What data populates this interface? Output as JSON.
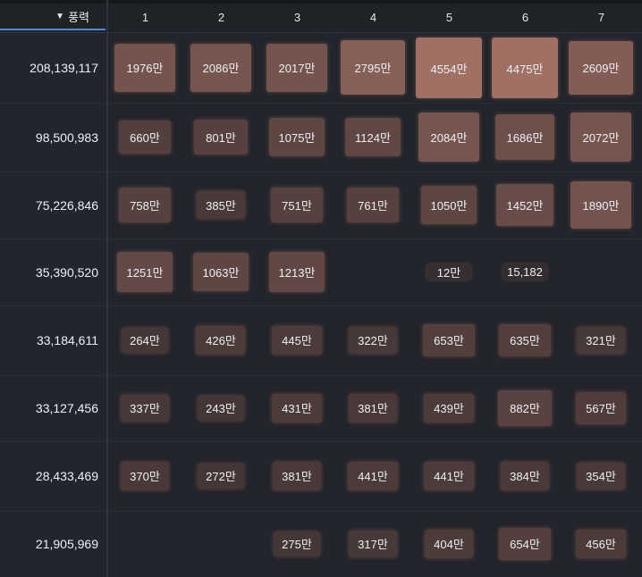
{
  "header": {
    "sort_label": "풍력",
    "sort_icon": "triangle-down-icon",
    "columns": [
      "1",
      "2",
      "3",
      "4",
      "5",
      "6",
      "7"
    ]
  },
  "rows": [
    {
      "label": "208,139,117",
      "cells": [
        "1976만",
        "2086만",
        "2017만",
        "2795만",
        "4554만",
        "4475만",
        "2609만"
      ]
    },
    {
      "label": "98,500,983",
      "cells": [
        "660만",
        "801만",
        "1075만",
        "1124만",
        "2084만",
        "1686만",
        "2072만"
      ]
    },
    {
      "label": "75,226,846",
      "cells": [
        "758만",
        "385만",
        "751만",
        "761만",
        "1050만",
        "1452만",
        "1890만"
      ]
    },
    {
      "label": "35,390,520",
      "cells": [
        "1251만",
        "1063만",
        "1213만",
        "",
        "12만",
        "15,182",
        ""
      ]
    },
    {
      "label": "33,184,611",
      "cells": [
        "264만",
        "426만",
        "445만",
        "322만",
        "653만",
        "635만",
        "321만"
      ]
    },
    {
      "label": "33,127,456",
      "cells": [
        "337만",
        "243만",
        "431만",
        "381만",
        "439만",
        "882만",
        "567만"
      ]
    },
    {
      "label": "28,433,469",
      "cells": [
        "370만",
        "272만",
        "381만",
        "441만",
        "441만",
        "384만",
        "354만"
      ]
    },
    {
      "label": "21,905,969",
      "cells": [
        "",
        "",
        "275만",
        "317만",
        "404만",
        "654만",
        "456만"
      ]
    }
  ],
  "colors": {
    "background": "#22252b",
    "cell_low": "#4a3632",
    "cell_high": "#a87468",
    "sort_underline": "#4a8fd6"
  }
}
